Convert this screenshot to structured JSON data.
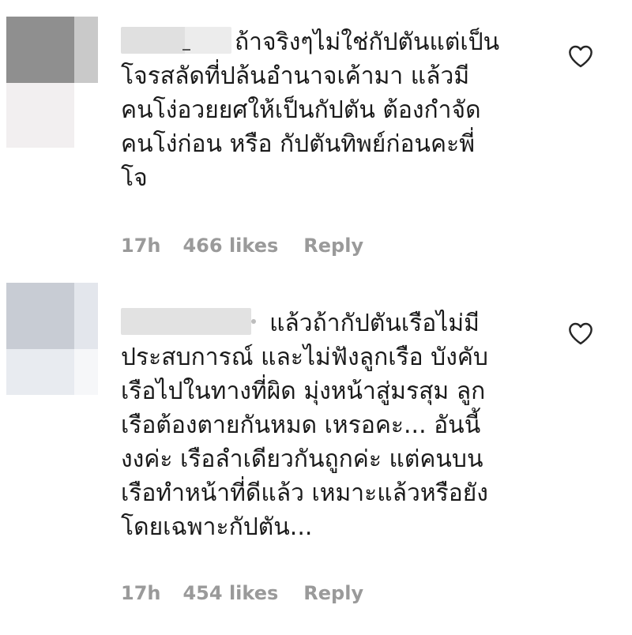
{
  "comments": [
    {
      "text_lines": [
        "ถ้าจริงๆไม่ใช่กัปตันแต่เป็น",
        "โจรสลัดที่ปล้นอำนาจเค้ามา แล้วมี",
        "คนโง่อวยยศให้เป็นกัปตัน ต้องกำจัด",
        "คนโง่ก่อน หรือ กัปตันทิพย์ก่อนคะพี่",
        "โจ"
      ],
      "time": "17h",
      "likes": "466 likes",
      "reply": "Reply",
      "like_icon": "heart-outline-icon"
    },
    {
      "text_lines": [
        "แล้วถ้ากัปตันเรือไม่มี",
        "ประสบการณ์ และไม่ฟังลูกเรือ บังคับ",
        "เรือไปในทางที่ผิด มุ่งหน้าสู่มรสุม ลูก",
        "เรือต้องตายกันหมด เหรอคะ... อันนี้",
        "งงค่ะ เรือลำเดียวกันถูกค่ะ แต่คนบน",
        "เรือทำหน้าที่ดีแล้ว เหมาะแล้วหรือยัง",
        "โดยเฉพาะกัปตัน..."
      ],
      "time": "17h",
      "likes": "454 likes",
      "reply": "Reply",
      "like_icon": "heart-outline-icon"
    }
  ],
  "colors": {
    "text": "#1a1a1a",
    "meta": "#9a9a9a",
    "icon": "#262626",
    "background": "#ffffff"
  }
}
